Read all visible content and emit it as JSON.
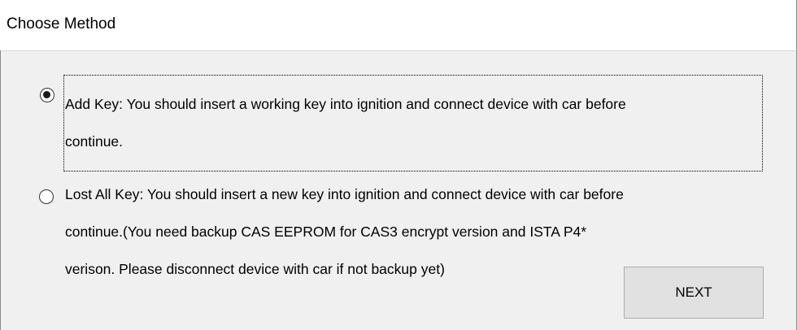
{
  "window": {
    "title": "Choose Method"
  },
  "options": [
    {
      "label_line1": "Add Key: You should insert a working key into ignition and connect device with car before",
      "label_line2": "continue.",
      "selected": true
    },
    {
      "label_line1": "Lost All Key: You should insert a new key into ignition and connect device with car before",
      "label_line2": "continue.(You need backup CAS EEPROM for CAS3 encrypt version and ISTA P4*",
      "label_line3": "verison. Please disconnect device with car if not backup yet)",
      "selected": false
    }
  ],
  "buttons": {
    "next_label": "NEXT"
  }
}
